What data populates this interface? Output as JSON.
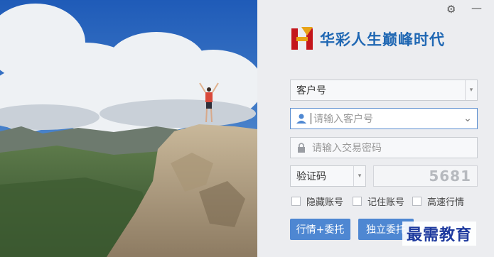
{
  "brand": {
    "title": "华彩人生巅峰时代"
  },
  "window": {
    "settings_icon": "gear-icon",
    "minimize_icon": "minimize-icon"
  },
  "form": {
    "account_type": {
      "value": "客户号"
    },
    "account": {
      "placeholder": "请输入客户号",
      "icon": "user-icon"
    },
    "password": {
      "placeholder": "请输入交易密码",
      "icon": "lock-icon"
    },
    "verify_type": {
      "value": "验证码"
    },
    "captcha_code": "5681"
  },
  "options": [
    {
      "label": "隐藏账号",
      "checked": false
    },
    {
      "label": "记住账号",
      "checked": false
    },
    {
      "label": "高速行情",
      "checked": false
    }
  ],
  "buttons": {
    "quote_trade": "行情+委托",
    "standalone_trade": "独立委托"
  },
  "watermark": "最需教育",
  "colors": {
    "accent": "#4e87d2",
    "brand_blue": "#1f67b3",
    "logo_red": "#c4161c"
  }
}
